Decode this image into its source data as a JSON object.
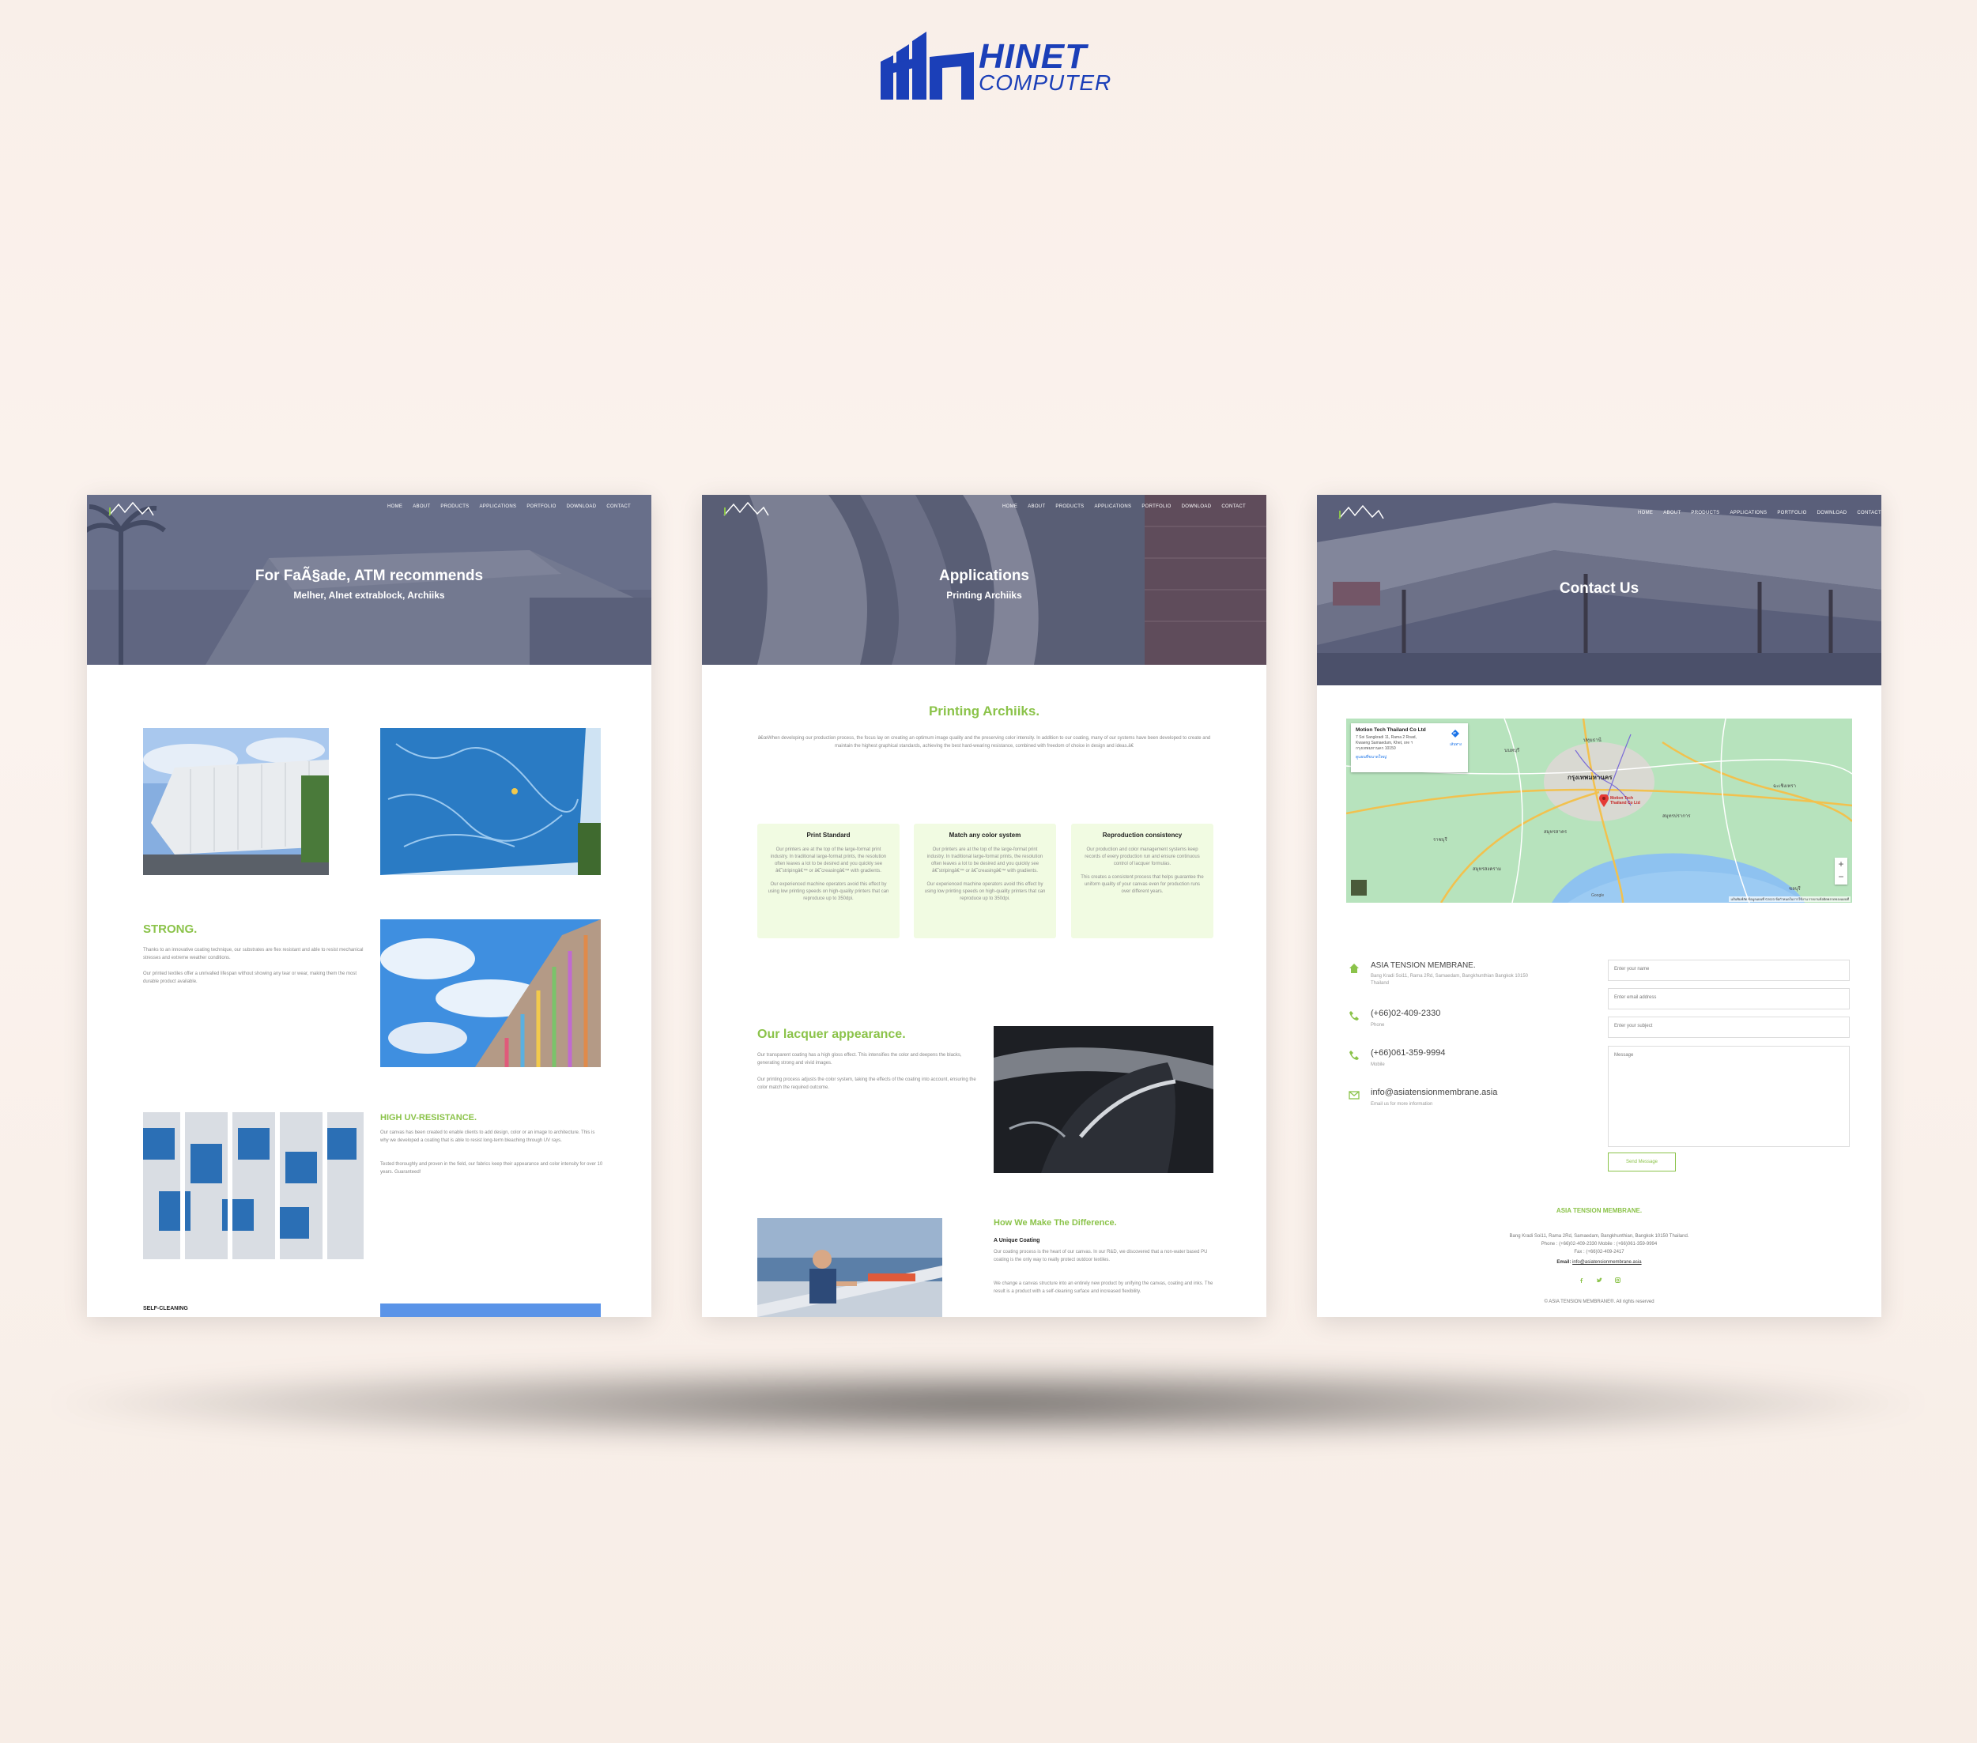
{
  "brand": {
    "name_line1": "HINET",
    "name_line2": "COMPUTER",
    "color": "#1b3fb8"
  },
  "accent_color": "#8bc34a",
  "nav": [
    "HOME",
    "ABOUT",
    "PRODUCTS",
    "APPLICATIONS",
    "PORTFOLIO",
    "DOWNLOAD",
    "CONTACT"
  ],
  "screen1": {
    "hero_title": "For FaÃ§ade, ATM recommends",
    "hero_subtitle": "Melher, Alnet extrablock, Archiiks",
    "strong_title": "STRONG.",
    "strong_p1": "Thanks to an innovative coating technique, our substrates are flex resistant and able to resist mechanical stresses and extreme weather conditions.",
    "strong_p2": "Our printed textiles offer a unrivalled lifespan without showing any tear or wear, making them the most durable product available.",
    "uv_title": "HIGH UV-RESISTANCE.",
    "uv_p1": "Our canvas has been created to enable clients to add design, color or an image to architecture. This is why we developed a coating that is able to resist long-term bleaching through UV rays.",
    "uv_p2": "Tested thoroughly and proven in the field, our fabrics keep their appearance and color intensity for over 10 years. Guaranteed!",
    "self_title": "SELF-CLEANING"
  },
  "screen2": {
    "hero_title": "Applications",
    "hero_subtitle": "Printing Archiiks",
    "section_title": "Printing Archiiks.",
    "intro": "â€œWhen developing our production process, the focus lay on creating an optimum image quality and the preserving color intensity. In addition to our coating, many of our systems have been developed to create and maintain the highest graphical standards, achieving the best hard-wearing resistance, combined with freedom of choice in design and ideas.â€",
    "cards": [
      {
        "title": "Print Standard",
        "p1": "Our printers are at the top of the large-format print industry. In traditional large-format prints, the resolution often leaves a lot to be desired and you quickly see â€˜stripingâ€™ or â€˜creasingâ€™ with gradients.",
        "p2": "Our experienced machine operators avoid this effect by using low printing speeds on high-quality printers that can reproduce up to 350dpi."
      },
      {
        "title": "Match any color system",
        "p1": "Our printers are at the top of the large-format print industry. In traditional large-format prints, the resolution often leaves a lot to be desired and you quickly see â€˜stripingâ€™ or â€˜creasingâ€™ with gradients.",
        "p2": "Our experienced machine operators avoid this effect by using low printing speeds on high-quality printers that can reproduce up to 350dpi."
      },
      {
        "title": "Reproduction consistency",
        "p1": "Our production and color management systems keep records of every production run and ensure continuous control of lacquer formulas.",
        "p2": "This creates a consistent process that helps guarantee the uniform quality of your canvas even for production runs over different years."
      }
    ],
    "lacquer_title": "Our lacquer appearance.",
    "lacquer_p1": "Our transparent coating has a high gloss effect. This intensifies the color and deepens the blacks, generating strong and vivid images.",
    "lacquer_p2": "Our printing process adjusts the color system, taking the effects of the coating into account, ensuring the color match the required outcome.",
    "diff_title": "How We Make The Difference.",
    "diff_sub": "A Unique Coating",
    "diff_p1": "Our coating process is the heart of our canvas. In our R&D, we discovered that a non-water based PU coating is the only way to really protect outdoor textiles.",
    "diff_p2": "We change a canvas structure into an entirely new product by unifying the canvas, coating and inks. The result is a product with a self-cleaning surface and increased flexibility."
  },
  "screen3": {
    "hero_title": "Contact Us",
    "map": {
      "place_name": "Motion Tech Thailand Co Ltd",
      "place_addr": "7 Soi Sangkradi 11, Rama 2 Road, Kwaeng Samaedum, Khet, ore ฯ กรุงเทพมหานคร 10150",
      "directions": "เส้นทาง",
      "larger_map": "ดูแผนที่ขนาดใหญ่",
      "pin_label": "Motion Tech Thailand Co Ltd",
      "city_main": "กรุงเทพมหานคร",
      "labels": [
        "ปทุมธานี",
        "นนทบุรี",
        "สมุทรปราการ",
        "ฉะเชิงเทรา",
        "สมุทรสาคร",
        "ราชบุรี",
        "สมุทรสงคราม",
        "ชลบุรี"
      ],
      "zoom_in": "+",
      "zoom_out": "−",
      "google": "Google",
      "attribution": "แป้นพิมพ์ลัด  ข้อมูลแผนที่ ©2023  ข้อกำหนดในการใช้งาน  รายงานข้อผิดพลาดของแผนที่"
    },
    "company": "ASIA TENSION MEMBRANE.",
    "address": "Bang Kradi Soi11, Rama 2Rd, Samaedam, Bangkhunthian Bangkok 10150 Thailand",
    "phone": "(+66)02-409-2330",
    "phone_label": "Phone",
    "mobile": "(+66)061-359-9994",
    "mobile_label": "Mobile",
    "email": "info@asiatensionmembrane.asia",
    "email_label": "Email us for more information",
    "form": {
      "name": "Enter your name",
      "email": "Enter email address",
      "subject": "Enter your subject",
      "message": "Message",
      "send": "Send Message"
    },
    "footer_company": "ASIA TENSION MEMBRANE.",
    "footer_addr": "Bang Kradi Soi11, Rama 2Rd, Samaedam, Bangkhunthian, Bangkok 10150 Thailand.",
    "footer_phone": "Phone : (+66)02-409-2330 Mobile : (+66)061-359-9994",
    "footer_fax": "Fax : (+66)02-409-2417",
    "footer_email_label": "Email:",
    "footer_email": "info@asiatensionmembrane.asia",
    "copyright": "© ASIA TENSION MEMBRANE®. All rights reserved"
  }
}
